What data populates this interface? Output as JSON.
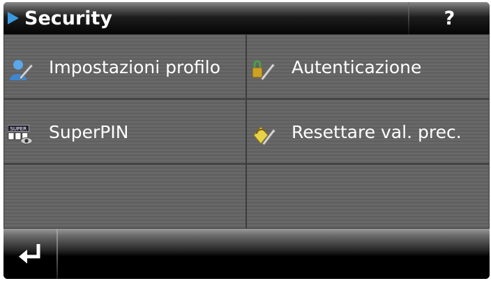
{
  "header": {
    "title": "Security",
    "help_label": "?"
  },
  "menu": {
    "items": [
      {
        "label": "Impostazioni profilo",
        "icon": "user-wrench-icon"
      },
      {
        "label": "Autenticazione",
        "icon": "lock-wrench-icon"
      },
      {
        "label": "SuperPIN",
        "icon": "superpin-icon",
        "icon_text": "SUPER"
      },
      {
        "label": "Resettare val. prec.",
        "icon": "reset-wrench-icon"
      }
    ]
  },
  "footer": {
    "back_icon": "return-arrow-icon"
  },
  "colors": {
    "accent": "#3a9be0",
    "header_bg": "#050505",
    "tile_bg": "#636363",
    "text": "#ffffff"
  }
}
